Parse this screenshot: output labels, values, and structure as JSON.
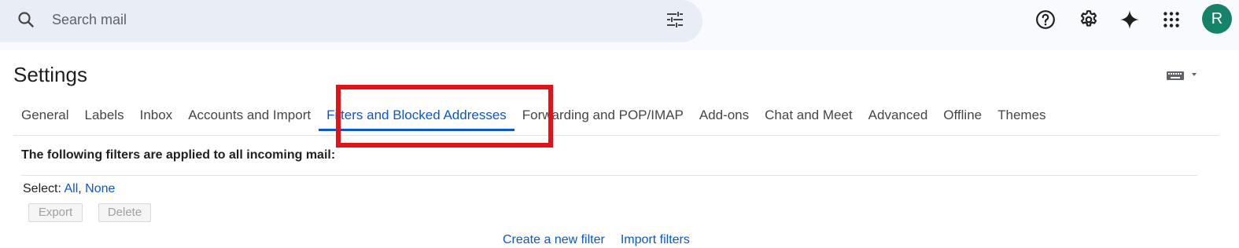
{
  "search": {
    "placeholder": "Search mail",
    "icon": "search-icon",
    "options_icon": "tune-icon"
  },
  "toolbar": {
    "icons": [
      "help-icon",
      "settings-gear-icon",
      "gemini-sparkle-icon",
      "apps-grid-icon"
    ],
    "avatar_letter": "R",
    "avatar_color": "#16826a"
  },
  "page": {
    "title": "Settings",
    "input_tools_icon": "keyboard-icon"
  },
  "tabs": [
    {
      "label": "General"
    },
    {
      "label": "Labels"
    },
    {
      "label": "Inbox"
    },
    {
      "label": "Accounts and Import"
    },
    {
      "label": "Filters and Blocked Addresses",
      "active": true
    },
    {
      "label": "Forwarding and POP/IMAP"
    },
    {
      "label": "Add-ons"
    },
    {
      "label": "Chat and Meet"
    },
    {
      "label": "Advanced"
    },
    {
      "label": "Offline"
    },
    {
      "label": "Themes"
    }
  ],
  "filters": {
    "description": "The following filters are applied to all incoming mail:",
    "select_label": "Select:",
    "select_all": "All",
    "select_separator": ",",
    "select_none": "None",
    "export_label": "Export",
    "delete_label": "Delete",
    "create_filter": "Create a new filter",
    "import_filters": "Import filters"
  },
  "colors": {
    "accent": "#0b57d0",
    "highlight_box": "#e0131b",
    "search_bg": "#e9eef6",
    "topbar_bg": "#f8fafd"
  }
}
